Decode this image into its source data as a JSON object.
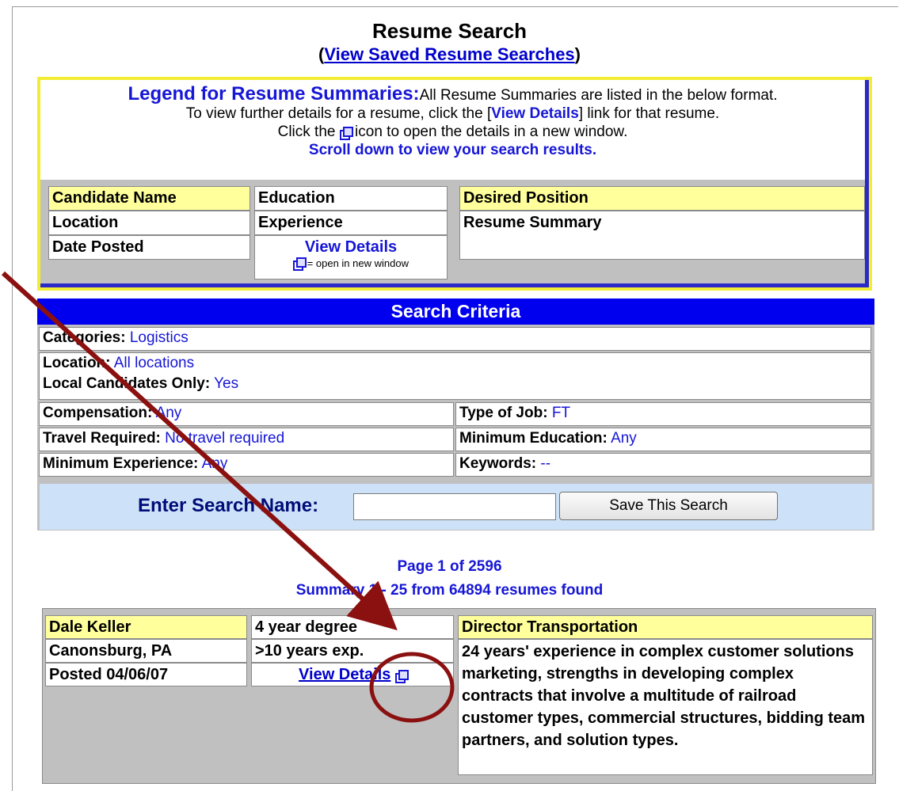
{
  "header": {
    "title": "Resume Search",
    "subtitle_open": "(",
    "saved_link": "View Saved Resume Searches",
    "subtitle_close": ")"
  },
  "legend": {
    "heading": "Legend for Resume Summaries:",
    "line1": "All Resume Summaries are listed in the below format.",
    "line2_pre": "To view further details for a resume, click the [",
    "line2_link": "View Details",
    "line2_post": "] link for that resume.",
    "line3_pre": "Click the",
    "line3_post": "icon to open the details in a new window.",
    "line4": "Scroll down to view your search results.",
    "cells": {
      "candidate_name": "Candidate Name",
      "location": "Location",
      "date_posted": "Date Posted",
      "education": "Education",
      "experience": "Experience",
      "view_details": "View Details",
      "open_new_window": "= open in new window",
      "desired_position": "Desired Position",
      "resume_summary": "Resume Summary"
    }
  },
  "criteria": {
    "header": "Search Criteria",
    "categories_label": "Categories:",
    "categories_value": "Logistics",
    "location_label": "Location:",
    "location_value": "All locations",
    "local_label": "Local Candidates Only:",
    "local_value": "Yes",
    "compensation_label": "Compensation:",
    "compensation_value": "Any",
    "jobtype_label": "Type of Job:",
    "jobtype_value": "FT",
    "travel_label": "Travel Required:",
    "travel_value": "No travel required",
    "min_edu_label": "Minimum Education:",
    "min_edu_value": "Any",
    "min_exp_label": "Minimum Experience:",
    "min_exp_value": "Any",
    "keywords_label": "Keywords:",
    "keywords_value": "--",
    "search_name_label": "Enter Search Name:",
    "search_name_value": "",
    "save_button": "Save This Search"
  },
  "pager": {
    "page_pre": "Page ",
    "page_num": "1",
    "page_post": " of 2596",
    "summary": "Summary 1 - 25 from 64894 resumes found"
  },
  "result": {
    "name": "Dale Keller",
    "location": "Canonsburg, PA",
    "posted": "Posted 04/06/07",
    "education": "4 year degree",
    "experience": ">10 years exp.",
    "view_details": "View Details",
    "desired_position": "Director Transportation",
    "summary": "24 years' experience in complex customer solutions marketing, strengths in developing complex contracts that involve a multitude of railroad customer types, commercial structures, bidding team partners, and solution types."
  }
}
